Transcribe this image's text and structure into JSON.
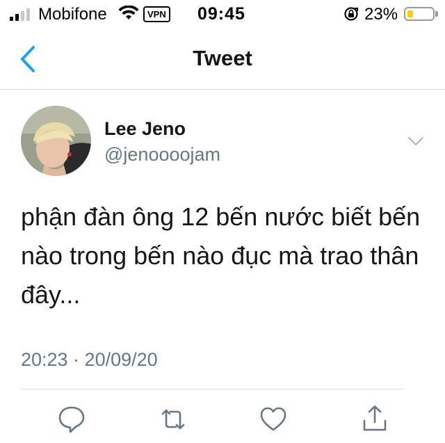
{
  "status_bar": {
    "carrier": "Mobifone",
    "vpn_label": "VPN",
    "time": "09:45",
    "battery_percent": "23%",
    "battery_level": 0.23,
    "icons": [
      "signal-icon",
      "wifi-icon",
      "rotation-lock-icon",
      "battery-icon"
    ]
  },
  "nav": {
    "title": "Tweet",
    "back_icon": "chevron-left-icon",
    "accent": "#1da1f2"
  },
  "tweet": {
    "author_name": "Lee Jeno",
    "handle": "@jenoooojam",
    "text": "phận đàn ông 12 bến nước biết bến nào trong bến nào đục mà trao thân đây...",
    "timestamp": "20:23 · 20/09/20",
    "menu_icon": "chevron-down-icon"
  },
  "actions": [
    {
      "name": "reply",
      "icon": "comment-icon"
    },
    {
      "name": "retweet",
      "icon": "retweet-icon"
    },
    {
      "name": "like",
      "icon": "heart-icon"
    },
    {
      "name": "share",
      "icon": "share-icon"
    }
  ],
  "colors": {
    "text_primary": "#14171a",
    "text_secondary": "#657786",
    "icon_gray": "#657786",
    "battery_fill": "#ffcc00"
  }
}
